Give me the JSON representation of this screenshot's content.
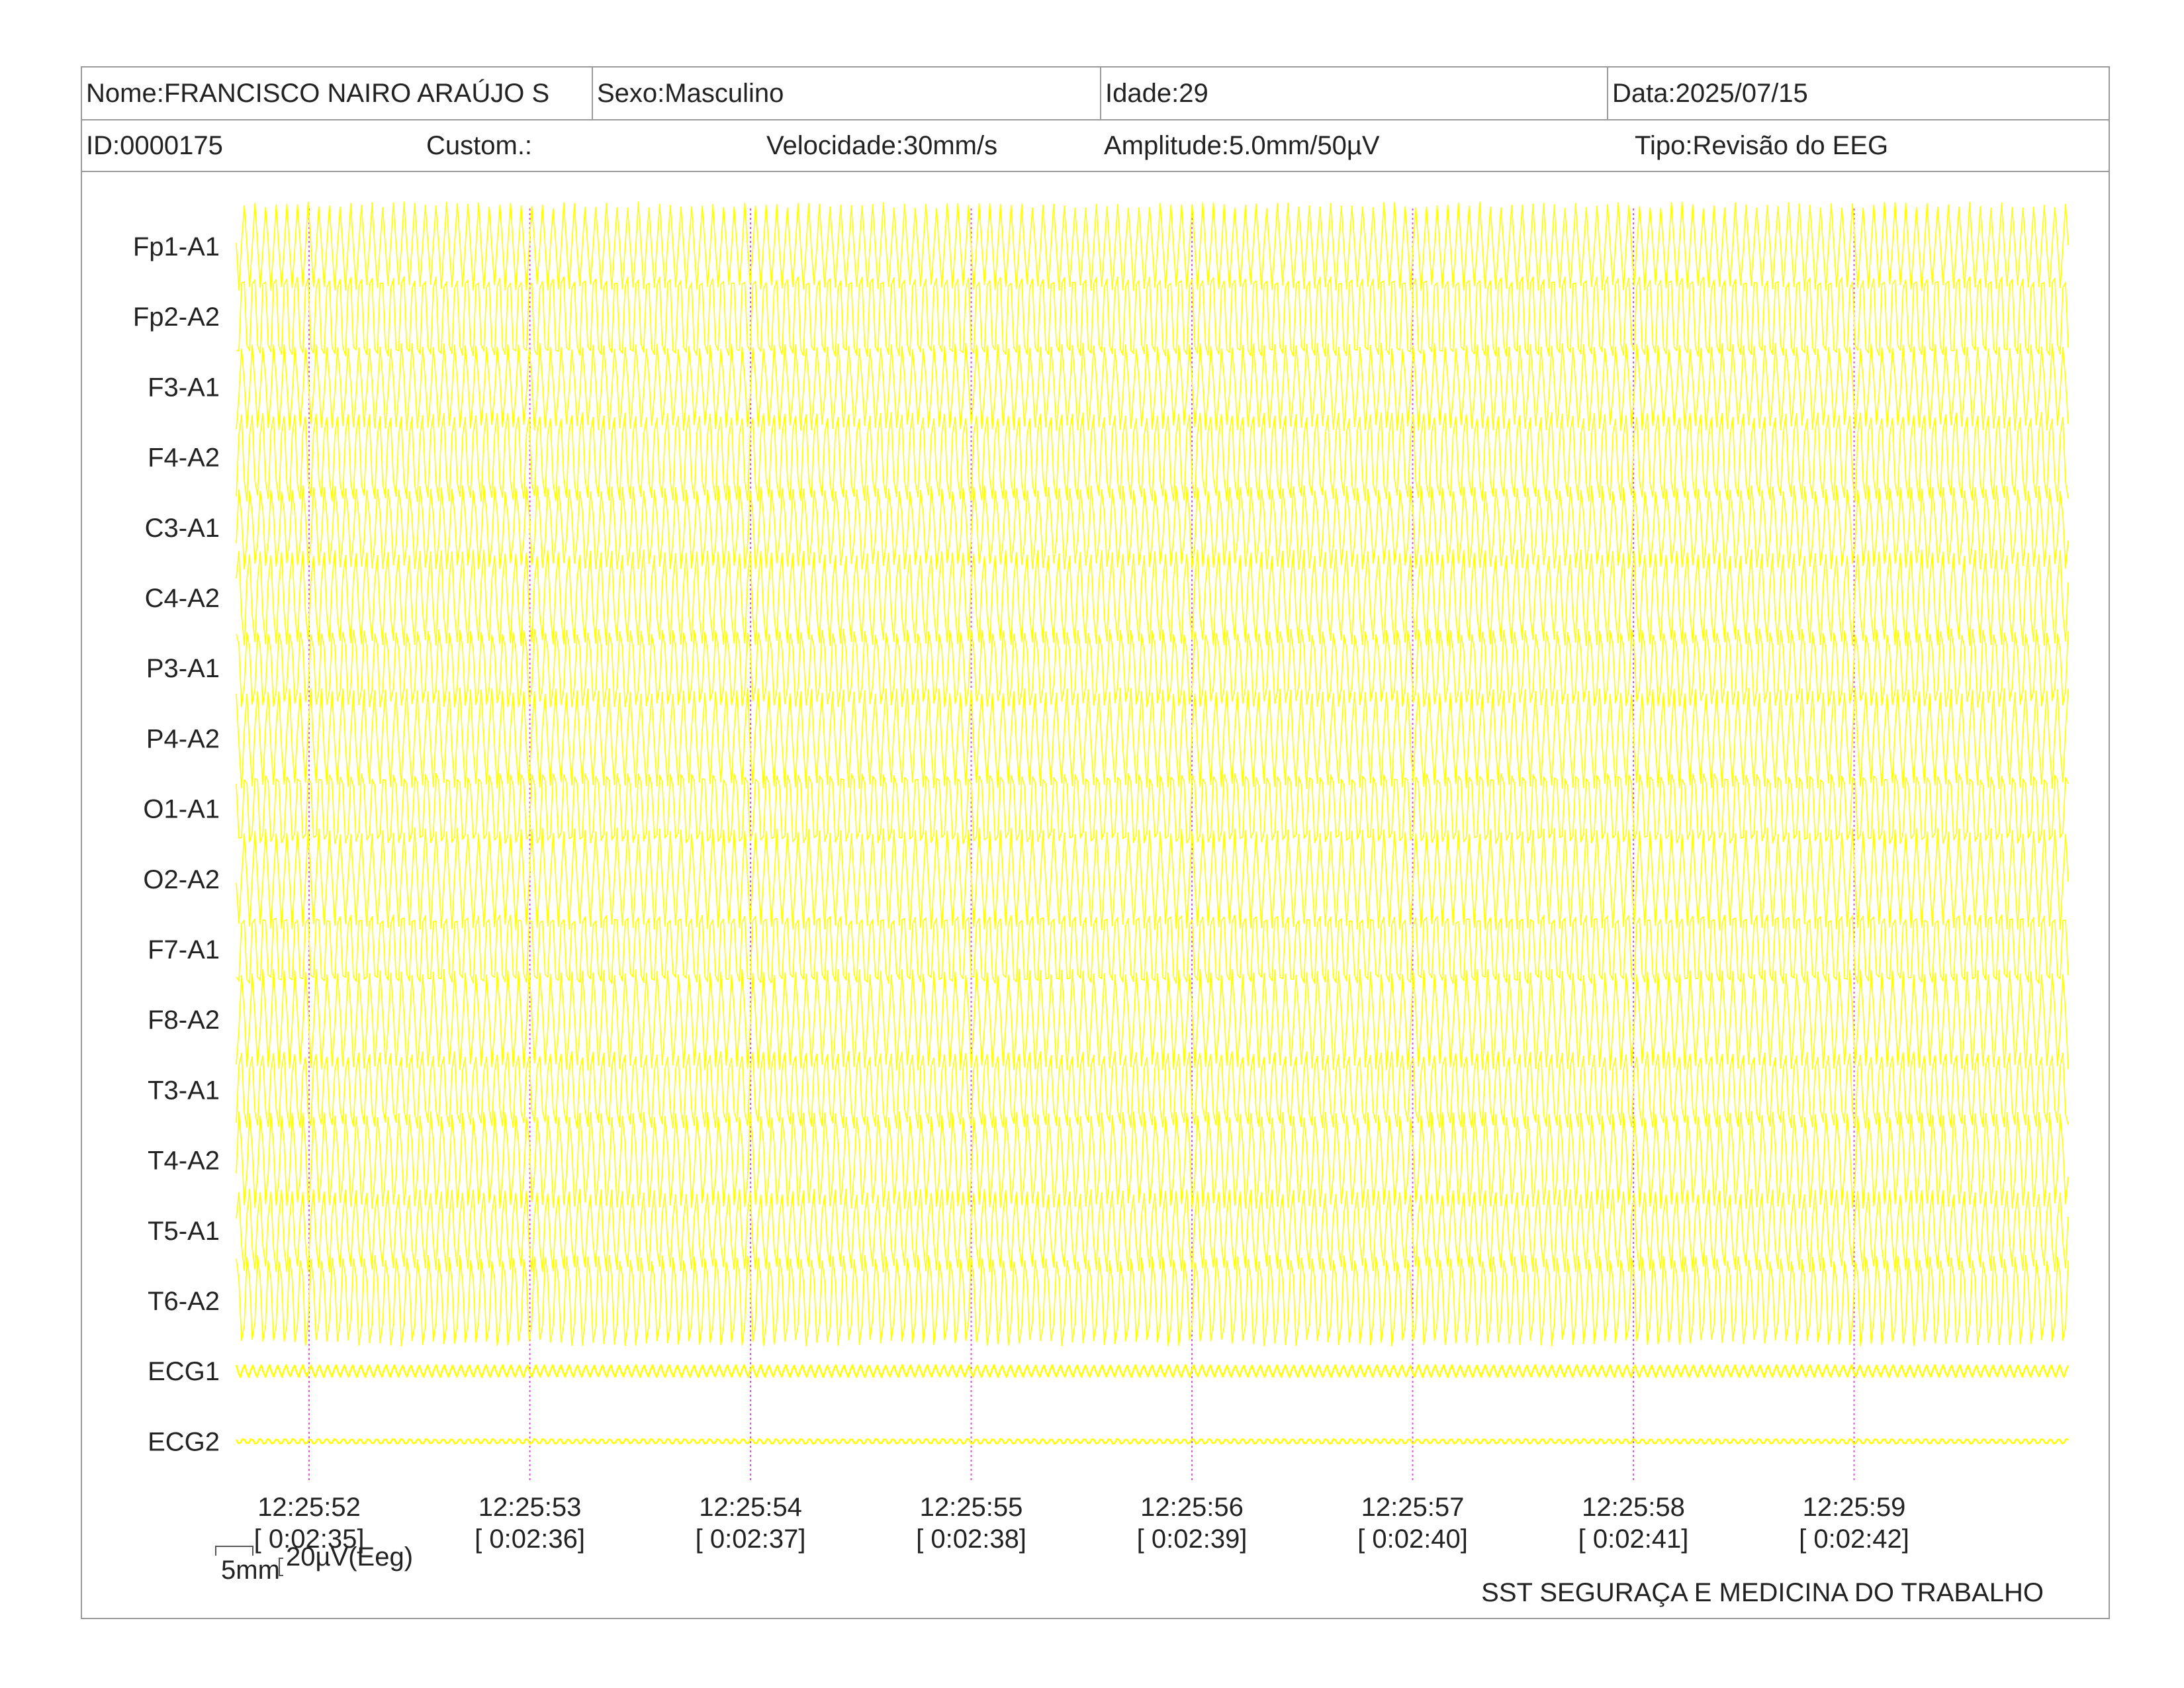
{
  "header": {
    "nome": "Nome:FRANCISCO NAIRO ARAÚJO S",
    "sexo": "Sexo:Masculino",
    "idade": "Idade:29",
    "data": "Data:2025/07/15",
    "id": "ID:0000175",
    "custom": "Custom.:",
    "velocidade": "Velocidade:30mm/s",
    "amplitude": "Amplitude:5.0mm/50µV",
    "tipo": "Tipo:Revisão do EEG"
  },
  "chart_data": {
    "type": "line",
    "trace_color": "#ffff00",
    "marker_color": "#dd55dd",
    "channels": [
      {
        "name": "Fp1-A1",
        "type": "eeg"
      },
      {
        "name": "Fp2-A2",
        "type": "eeg"
      },
      {
        "name": "F3-A1",
        "type": "eeg"
      },
      {
        "name": "F4-A2",
        "type": "eeg"
      },
      {
        "name": "C3-A1",
        "type": "eeg"
      },
      {
        "name": "C4-A2",
        "type": "eeg"
      },
      {
        "name": "P3-A1",
        "type": "eeg"
      },
      {
        "name": "P4-A2",
        "type": "eeg"
      },
      {
        "name": "O1-A1",
        "type": "eeg"
      },
      {
        "name": "O2-A2",
        "type": "eeg"
      },
      {
        "name": "F7-A1",
        "type": "eeg"
      },
      {
        "name": "F8-A2",
        "type": "eeg"
      },
      {
        "name": "T3-A1",
        "type": "eeg"
      },
      {
        "name": "T4-A2",
        "type": "eeg"
      },
      {
        "name": "T5-A1",
        "type": "eeg"
      },
      {
        "name": "T6-A2",
        "type": "eeg"
      },
      {
        "name": "ECG1",
        "type": "ecg"
      },
      {
        "name": "ECG2",
        "type": "ecg"
      }
    ],
    "time_axis": {
      "start_seconds": 0,
      "end_seconds": 8.3,
      "ticks": [
        {
          "t": 0.33,
          "clock": "12:25:52",
          "elapsed": "[ 0:02:35]"
        },
        {
          "t": 1.33,
          "clock": "12:25:53",
          "elapsed": "[ 0:02:36]"
        },
        {
          "t": 2.33,
          "clock": "12:25:54",
          "elapsed": "[ 0:02:37]"
        },
        {
          "t": 3.33,
          "clock": "12:25:55",
          "elapsed": "[ 0:02:38]"
        },
        {
          "t": 4.33,
          "clock": "12:25:56",
          "elapsed": "[ 0:02:39]"
        },
        {
          "t": 5.33,
          "clock": "12:25:57",
          "elapsed": "[ 0:02:40]"
        },
        {
          "t": 6.33,
          "clock": "12:25:58",
          "elapsed": "[ 0:02:41]"
        },
        {
          "t": 7.33,
          "clock": "12:25:59",
          "elapsed": "[ 0:02:42]"
        }
      ]
    },
    "calibration": {
      "time_label": "5mm",
      "amplitude_label": "20µV(Eeg)"
    }
  },
  "footer": {
    "organization": "SST SEGURAÇA E MEDICINA DO TRABALHO"
  }
}
